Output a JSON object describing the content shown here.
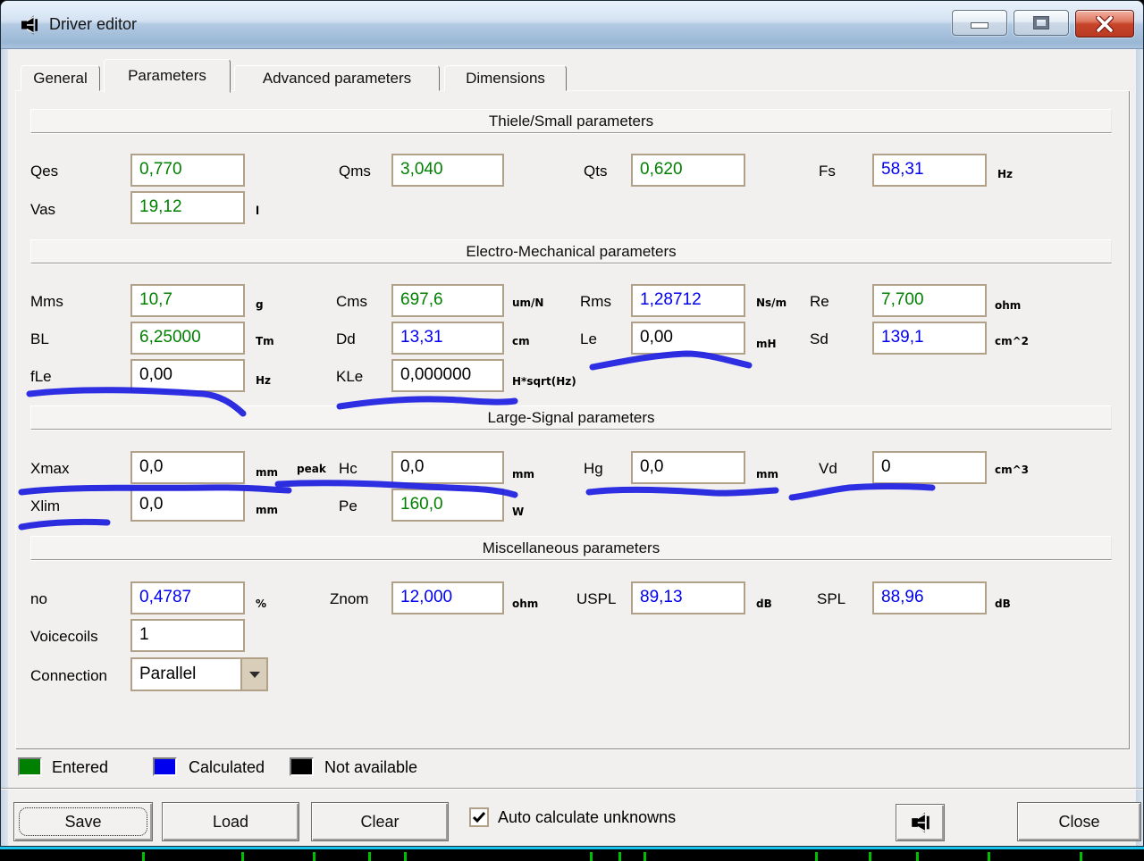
{
  "window": {
    "title": "Driver editor"
  },
  "tabs": [
    {
      "label": "General",
      "active": false
    },
    {
      "label": "Parameters",
      "active": true
    },
    {
      "label": "Advanced parameters",
      "active": false
    },
    {
      "label": "Dimensions",
      "active": false
    }
  ],
  "sections": {
    "thiele_small": {
      "title": "Thiele/Small parameters"
    },
    "electro_mechanical": {
      "title": "Electro-Mechanical parameters"
    },
    "large_signal": {
      "title": "Large-Signal parameters"
    },
    "miscellaneous": {
      "title": "Miscellaneous parameters"
    }
  },
  "fields": {
    "qes": {
      "label": "Qes",
      "value": "0,770",
      "unit": "",
      "status": "entered"
    },
    "qms": {
      "label": "Qms",
      "value": "3,040",
      "unit": "",
      "status": "entered"
    },
    "qts": {
      "label": "Qts",
      "value": "0,620",
      "unit": "",
      "status": "entered"
    },
    "fs": {
      "label": "Fs",
      "value": "58,31",
      "unit": "Hz",
      "status": "calculated"
    },
    "vas": {
      "label": "Vas",
      "value": "19,12",
      "unit": "l",
      "status": "entered"
    },
    "mms": {
      "label": "Mms",
      "value": "10,7",
      "unit": "g",
      "status": "entered"
    },
    "cms": {
      "label": "Cms",
      "value": "697,6",
      "unit": "um/N",
      "status": "entered"
    },
    "rms": {
      "label": "Rms",
      "value": "1,28712",
      "unit": "Ns/m",
      "status": "calculated"
    },
    "re": {
      "label": "Re",
      "value": "7,700",
      "unit": "ohm",
      "status": "entered"
    },
    "bl": {
      "label": "BL",
      "value": "6,25000",
      "unit": "Tm",
      "status": "entered"
    },
    "dd": {
      "label": "Dd",
      "value": "13,31",
      "unit": "cm",
      "status": "calculated"
    },
    "le": {
      "label": "Le",
      "value": "0,00",
      "unit": "mH",
      "status": "not_available"
    },
    "sd": {
      "label": "Sd",
      "value": "139,1",
      "unit": "cm^2",
      "status": "calculated"
    },
    "fle": {
      "label": "fLe",
      "value": "0,00",
      "unit": "Hz",
      "status": "not_available"
    },
    "kle": {
      "label": "KLe",
      "value": "0,000000",
      "unit": "H*sqrt(Hz)",
      "status": "not_available"
    },
    "xmax": {
      "label": "Xmax",
      "value": "0,0",
      "unit": "mm",
      "unit2": "peak",
      "status": "not_available"
    },
    "hc": {
      "label": "Hc",
      "value": "0,0",
      "unit": "mm",
      "status": "not_available"
    },
    "hg": {
      "label": "Hg",
      "value": "0,0",
      "unit": "mm",
      "status": "not_available"
    },
    "vd": {
      "label": "Vd",
      "value": "0",
      "unit": "cm^3",
      "status": "not_available"
    },
    "xlim": {
      "label": "Xlim",
      "value": "0,0",
      "unit": "mm",
      "status": "not_available"
    },
    "pe": {
      "label": "Pe",
      "value": "160,0",
      "unit": "W",
      "status": "entered"
    },
    "no": {
      "label": "no",
      "value": "0,4787",
      "unit": "%",
      "status": "calculated"
    },
    "znom": {
      "label": "Znom",
      "value": "12,000",
      "unit": "ohm",
      "status": "calculated"
    },
    "uspl": {
      "label": "USPL",
      "value": "89,13",
      "unit": "dB",
      "status": "calculated"
    },
    "spl": {
      "label": "SPL",
      "value": "88,96",
      "unit": "dB",
      "status": "calculated"
    },
    "voicecoils": {
      "label": "Voicecoils",
      "value": "1",
      "unit": "",
      "status": "not_available"
    },
    "connection": {
      "label": "Connection",
      "value": "Parallel",
      "status": "not_available"
    }
  },
  "legend": {
    "entered": "Entered",
    "calculated": "Calculated",
    "not_available": "Not available"
  },
  "colors": {
    "entered": "#008000",
    "calculated": "#0000ee",
    "not_available": "#000000",
    "annotation": "#2323e0",
    "tick_green": "#00bf00"
  },
  "footer": {
    "save": "Save",
    "load": "Load",
    "clear": "Clear",
    "auto_calc_label": "Auto calculate unknowns",
    "auto_calc_checked": true,
    "close": "Close"
  }
}
